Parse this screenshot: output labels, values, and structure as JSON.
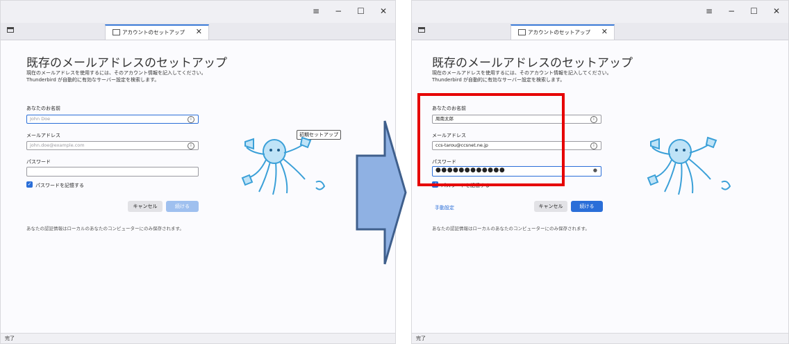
{
  "colors": {
    "accent": "#2a6ed8",
    "highlight": "#e60000",
    "arrow_fill": "#8fb1e3",
    "arrow_stroke": "#3f5f8c"
  },
  "left": {
    "window_controls": [
      "≡",
      "−",
      "☐",
      "✕"
    ],
    "tab": {
      "label": "アカウントのセットアップ",
      "close": "✕"
    },
    "title": "既存のメールアドレスのセットアップ",
    "intro_line1": "現在のメールアドレスを使用するには、そのアカウント情報を記入してください。",
    "intro_line2": "Thunderbird が自動的に有効なサーバー設定を検索します。",
    "name_label": "あなたのお名前",
    "name_placeholder": "John Doe",
    "email_label": "メールアドレス",
    "email_placeholder": "john.doe@example.com",
    "password_label": "パスワード",
    "remember_label": "パスワードを記憶する",
    "cancel_label": "キャンセル",
    "continue_label": "続ける",
    "note": "あなたの認証情報はローカルのあなたのコンピューターにのみ保存されます。",
    "badge": "初期セットアップ",
    "status": "完了"
  },
  "right": {
    "window_controls": [
      "≡",
      "−",
      "☐",
      "✕"
    ],
    "tab": {
      "label": "アカウントのセットアップ",
      "close": "✕"
    },
    "title": "既存のメールアドレスのセットアップ",
    "intro_line1": "現在のメールアドレスを使用するには、そのアカウント情報を記入してください。",
    "intro_line2": "Thunderbird が自動的に有効なサーバー設定を検索します。",
    "name_label": "あなたのお名前",
    "name_value": "周南太郎",
    "email_label": "メールアドレス",
    "email_value": "ccs-tarou@ccsnet.ne.jp",
    "password_label": "パスワード",
    "password_value": "●●●●●●●●●●●●",
    "remember_label": "パスワードを記憶する",
    "manual_label": "手動設定",
    "cancel_label": "キャンセル",
    "continue_label": "続ける",
    "note": "あなたの認証情報はローカルのあなたのコンピューターにのみ保存されます。",
    "status": "完了"
  }
}
